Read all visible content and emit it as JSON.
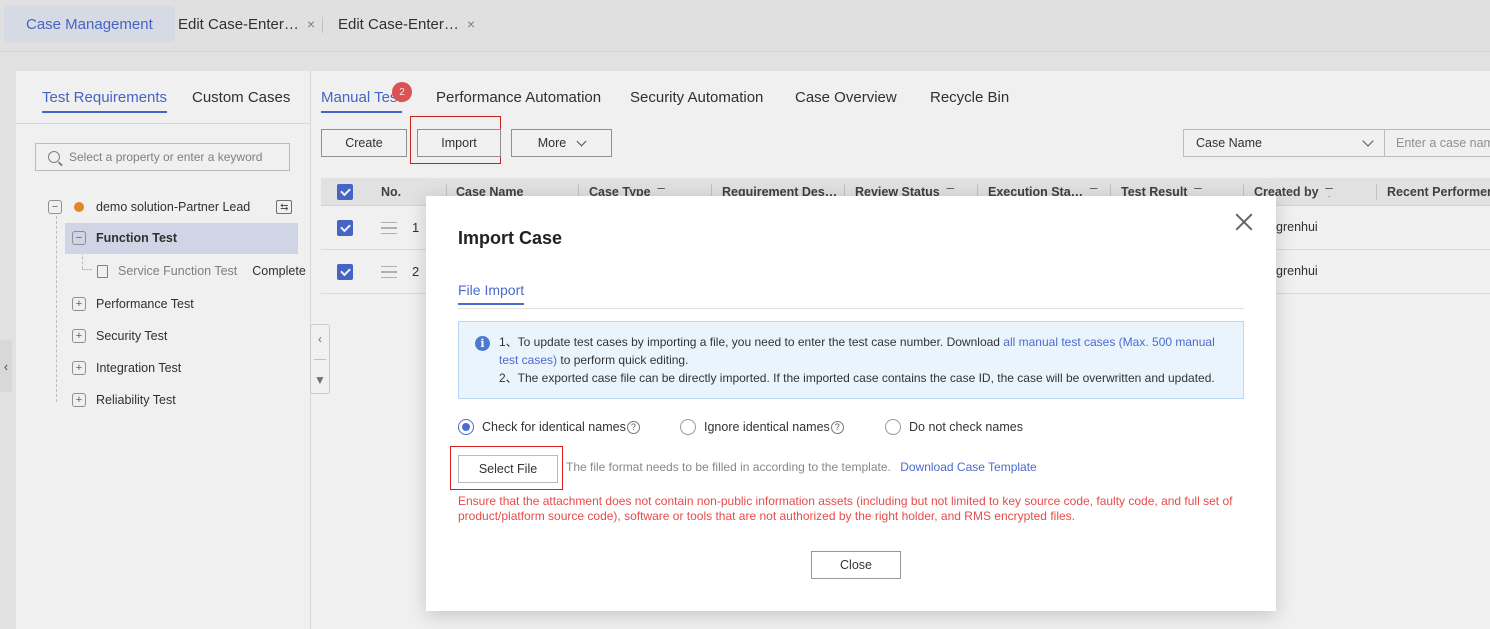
{
  "top_tabs": [
    {
      "label": "Case Management"
    },
    {
      "label": "Edit Case-Enter…",
      "close": "×"
    },
    {
      "label": "Edit Case-Enter…",
      "close": "×"
    }
  ],
  "left_panel": {
    "tabs": [
      "Test Requirements",
      "Custom Cases"
    ],
    "search_placeholder": "Select a property or enter a keyword",
    "tree": {
      "root": "demo solution-Partner Lead",
      "children": [
        {
          "label": "Function Test",
          "expanded": true,
          "selected": true,
          "children": [
            {
              "label": "Service Function Test",
              "status": "Complete"
            }
          ]
        },
        {
          "label": "Performance Test"
        },
        {
          "label": "Security Test"
        },
        {
          "label": "Integration Test"
        },
        {
          "label": "Reliability Test"
        }
      ]
    }
  },
  "main": {
    "tabs": [
      "Manual Test",
      "Performance Automation",
      "Security Automation",
      "Case Overview",
      "Recycle Bin"
    ],
    "manual_badge": "2",
    "toolbar": {
      "create": "Create",
      "import": "Import",
      "more": "More"
    },
    "filter_select": "Case Name",
    "filter_placeholder": "Enter a case name",
    "columns": [
      "No.",
      "Case Name",
      "Case Type",
      "Requirement Des…",
      "Review Status",
      "Execution Sta…",
      "Test Result",
      "Created by",
      "Recent Performer"
    ],
    "rows": [
      {
        "no": "1",
        "created_by": "grenhui"
      },
      {
        "no": "2",
        "created_by": "grenhui"
      }
    ]
  },
  "modal": {
    "title": "Import Case",
    "tab": "File Import",
    "info_line1_prefix": "1、To update test cases by importing a file, you need to enter the test case number. Download ",
    "info_link": "all manual test cases (Max. 500 manual test cases)",
    "info_line1_suffix": " to perform quick editing.",
    "info_line2": "2、The exported case file can be directly imported. If the imported case contains the case ID, the case will be overwritten and updated.",
    "radios": [
      {
        "label": "Check for identical names",
        "checked": true,
        "help": "?"
      },
      {
        "label": "Ignore identical names",
        "checked": false,
        "help": "?"
      },
      {
        "label": "Do not check names",
        "checked": false
      }
    ],
    "select_file": "Select File",
    "format_hint": "The file format needs to be filled in according to the template.",
    "download_template": "Download Case Template",
    "warning": "Ensure that the attachment does not contain non-public information assets (including but not limited to key source code, faulty code, and full set of product/platform source code), software or tools that are not authorized by the right holder, and RMS encrypted files.",
    "close": "Close"
  },
  "colors": {
    "accent": "#4a6bd0",
    "badge": "#e85858",
    "warning": "#e84a4a",
    "highlight": "#d42020"
  }
}
